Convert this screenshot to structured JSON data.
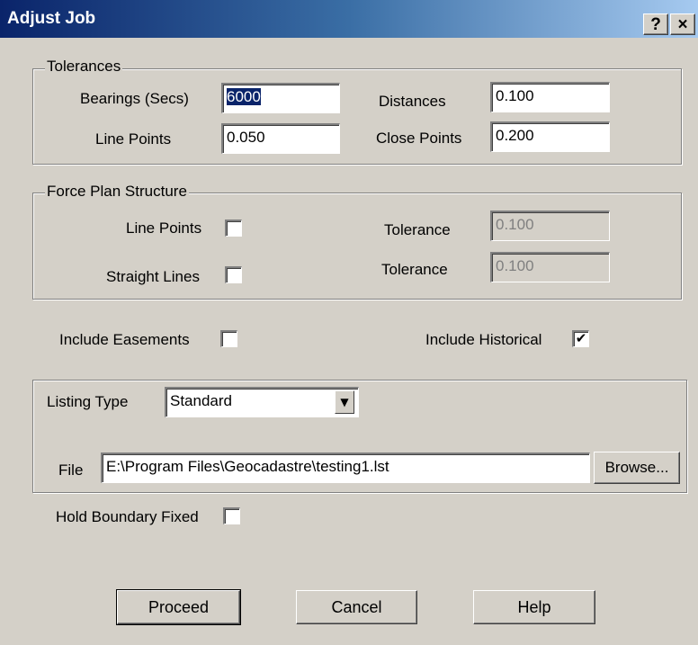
{
  "window": {
    "title": "Adjust Job",
    "help_label": "?",
    "close_label": "×"
  },
  "tolerances": {
    "legend": "Tolerances",
    "bearings_label": "Bearings (Secs)",
    "bearings_value": "6000",
    "distances_label": "Distances",
    "distances_value": "0.100",
    "line_points_label": "Line Points",
    "line_points_value": "0.050",
    "close_points_label": "Close Points",
    "close_points_value": "0.200"
  },
  "force_plan": {
    "legend": "Force Plan Structure",
    "line_points_label": "Line Points",
    "line_points_checked": false,
    "tolerance1_label": "Tolerance",
    "tolerance1_value": "0.100",
    "straight_lines_label": "Straight Lines",
    "straight_lines_checked": false,
    "tolerance2_label": "Tolerance",
    "tolerance2_value": "0.100"
  },
  "options": {
    "include_easements_label": "Include Easements",
    "include_easements_checked": false,
    "include_historical_label": "Include Historical",
    "include_historical_checked": true,
    "hold_boundary_label": "Hold Boundary Fixed",
    "hold_boundary_checked": false
  },
  "listing": {
    "type_label": "Listing Type",
    "type_value": "Standard",
    "file_label": "File",
    "file_value": "E:\\Program Files\\Geocadastre\\testing1.lst",
    "browse_label": "Browse..."
  },
  "buttons": {
    "proceed": "Proceed",
    "cancel": "Cancel",
    "help": "Help"
  },
  "icons": {
    "check": "✔",
    "dropdown_arrow": "▼"
  },
  "colors": {
    "dialog_bg": "#d4d0c8",
    "titlebar_start": "#0a246a",
    "titlebar_end": "#a6caf0",
    "selection_bg": "#0a246a"
  }
}
